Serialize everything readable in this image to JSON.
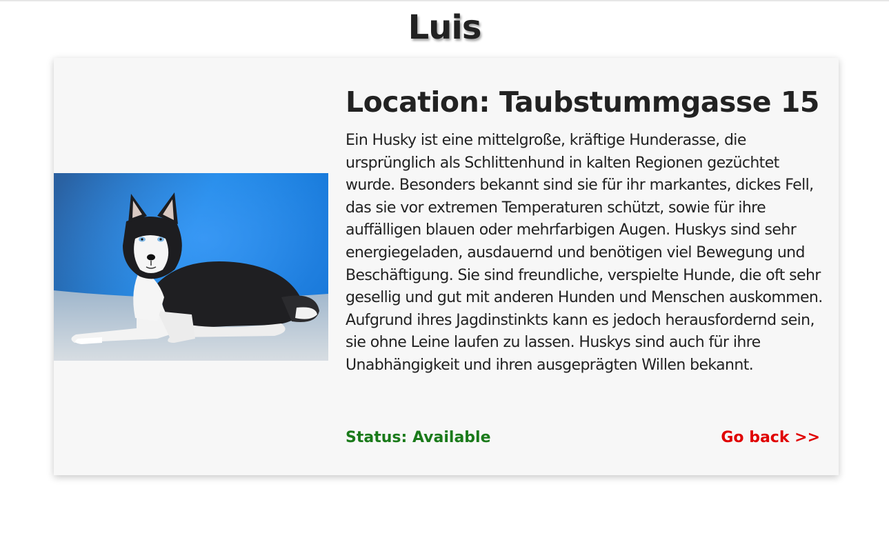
{
  "page": {
    "title": "Luis"
  },
  "card": {
    "location": "Location: Taubstummgasse 15",
    "description": "Ein Husky ist eine mittelgroße, kräftige Hunderasse, die ursprünglich als Schlittenhund in kalten Regionen gezüchtet wurde. Besonders bekannt sind sie für ihr markantes, dickes Fell, das sie vor extremen Temperaturen schützt, sowie für ihre auffälligen blauen oder mehrfarbigen Augen. Huskys sind sehr energiegeladen, ausdauernd und benötigen viel Bewegung und Beschäftigung. Sie sind freundliche, verspielte Hunde, die oft sehr gesellig und gut mit anderen Hunden und Menschen auskommen. Aufgrund ihres Jagdinstinkts kann es jedoch herausfordernd sein, sie ohne Leine laufen zu lassen. Huskys sind auch für ihre Unabhängigkeit und ihren ausgeprägten Willen bekannt.",
    "status": "Status: Available",
    "go_back": "Go back >>",
    "image_subject": "husky-dog-photo"
  },
  "colors": {
    "status": "#1a7a1a",
    "go_back": "#e00000",
    "card_bg": "#f7f7f7"
  }
}
